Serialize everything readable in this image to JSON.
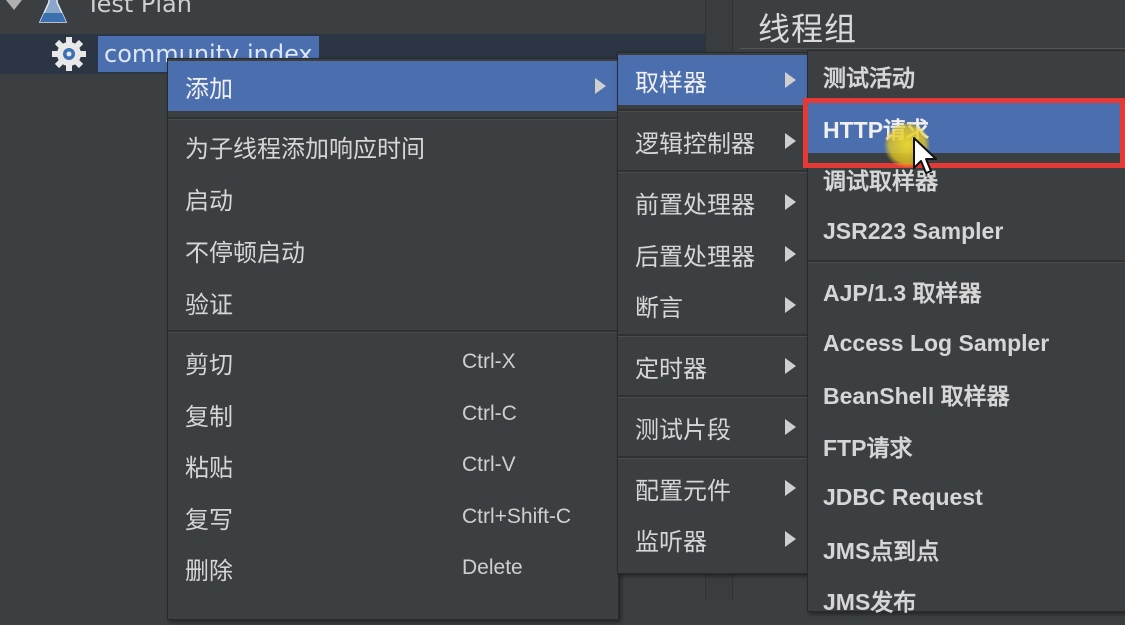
{
  "tree": {
    "test_plan_label": "Test Plan",
    "selected_item_label": "community index"
  },
  "right_panel": {
    "title": "线程组"
  },
  "context_menu": {
    "items": [
      {
        "label": "添加"
      },
      {
        "label": "为子线程添加响应时间"
      },
      {
        "label": "启动"
      },
      {
        "label": "不停顿启动"
      },
      {
        "label": "验证"
      },
      {
        "label": "剪切",
        "shortcut": "Ctrl-X"
      },
      {
        "label": "复制",
        "shortcut": "Ctrl-C"
      },
      {
        "label": "粘贴",
        "shortcut": "Ctrl-V"
      },
      {
        "label": "复写",
        "shortcut": "Ctrl+Shift-C"
      },
      {
        "label": "删除",
        "shortcut": "Delete"
      }
    ]
  },
  "add_submenu": {
    "items": [
      {
        "label": "取样器"
      },
      {
        "label": "逻辑控制器"
      },
      {
        "label": "前置处理器"
      },
      {
        "label": "后置处理器"
      },
      {
        "label": "断言"
      },
      {
        "label": "定时器"
      },
      {
        "label": "测试片段"
      },
      {
        "label": "配置元件"
      },
      {
        "label": "监听器"
      }
    ]
  },
  "sampler_submenu": {
    "items": [
      {
        "label": "测试活动"
      },
      {
        "label": "HTTP请求"
      },
      {
        "label": "调试取样器"
      },
      {
        "label": "JSR223 Sampler"
      },
      {
        "label": "AJP/1.3 取样器"
      },
      {
        "label": "Access Log Sampler"
      },
      {
        "label": "BeanShell 取样器"
      },
      {
        "label": "FTP请求"
      },
      {
        "label": "JDBC Request"
      },
      {
        "label": "JMS点到点"
      },
      {
        "label": "JMS发布"
      }
    ]
  },
  "colors": {
    "menu_bg": "#3c3f41",
    "highlight": "#4b6eaf",
    "annotation_box": "#e53935",
    "cursor_halo": "#f0dc28"
  }
}
